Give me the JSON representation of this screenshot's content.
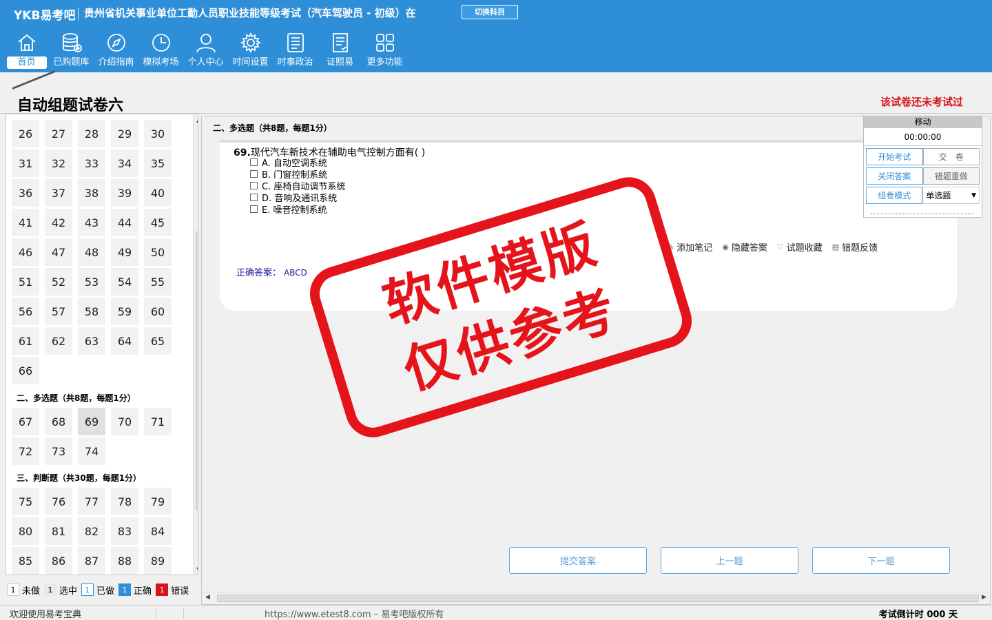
{
  "header": {
    "logo": "YKB易考吧",
    "exam_title": "贵州省机关事业单位工勤人员职业技能等级考试（汽车驾驶员 - 初级）在",
    "switch_label": "切换科目",
    "nav": [
      {
        "label": "首页",
        "icon": "home-icon"
      },
      {
        "label": "已购题库",
        "icon": "database-icon"
      },
      {
        "label": "介绍指南",
        "icon": "compass-icon"
      },
      {
        "label": "模拟考场",
        "icon": "clock-icon"
      },
      {
        "label": "个人中心",
        "icon": "user-icon"
      },
      {
        "label": "时间设置",
        "icon": "gear-icon"
      },
      {
        "label": "时事政治",
        "icon": "news-icon"
      },
      {
        "label": "证照易",
        "icon": "document-icon"
      },
      {
        "label": "更多功能",
        "icon": "grid-icon"
      }
    ]
  },
  "paper": {
    "title": "自动组题试卷六",
    "status": "该试卷还未考试过"
  },
  "left": {
    "group1": [
      "26",
      "27",
      "28",
      "29",
      "30",
      "31",
      "32",
      "33",
      "34",
      "35",
      "36",
      "37",
      "38",
      "39",
      "40",
      "41",
      "42",
      "43",
      "44",
      "45",
      "46",
      "47",
      "48",
      "49",
      "50",
      "51",
      "52",
      "53",
      "54",
      "55",
      "56",
      "57",
      "58",
      "59",
      "60",
      "61",
      "62",
      "63",
      "64",
      "65",
      "66"
    ],
    "section2_label": "二、多选题（共8题，每题1分）",
    "group2": [
      "67",
      "68",
      "69",
      "70",
      "71",
      "72",
      "73",
      "74"
    ],
    "section3_label": "三、判断题（共30题，每题1分）",
    "group3": [
      "75",
      "76",
      "77",
      "78",
      "79",
      "80",
      "81",
      "82",
      "83",
      "84",
      "85",
      "86",
      "87",
      "88",
      "89"
    ],
    "selected": "69"
  },
  "legend": {
    "undone_num": "1",
    "undone_label": "未做",
    "sel_num": "1",
    "sel_label": "选中",
    "done_num": "1",
    "done_label": "已做",
    "right_num": "1",
    "right_label": "正确",
    "wrong_num": "1",
    "wrong_label": "错误"
  },
  "main": {
    "section_label": "二、多选题（共8题，每题1分）",
    "question_num": "69.",
    "question_text": "现代汽车新技术在辅助电气控制方面有( )",
    "options": [
      "A. 自动空调系统",
      "B. 门窗控制系统",
      "C. 座椅自动调节系统",
      "D. 音响及通讯系统",
      "E. 噪音控制系统"
    ],
    "tools": {
      "add_note": "添加笔记",
      "hide_answer": "隐藏答案",
      "favorite": "试题收藏",
      "feedback": "错题反馈"
    },
    "answer_label": "正确答案：",
    "answer_value": "ABCD",
    "submit": "提交答案",
    "prev": "上一题",
    "next": "下一题"
  },
  "control": {
    "move": "移动",
    "time": "00:00:00",
    "start": "开始考试",
    "hand_in": "交　卷",
    "close_answer": "关闭答案",
    "redo_wrong": "错题重做",
    "mode": "组卷模式",
    "type_value": "单选题"
  },
  "stamp": {
    "line1": "软件模版",
    "line2": "仅供参考"
  },
  "statusbar": {
    "welcome": "欢迎使用易考宝典",
    "copyright": "https://www.etest8.com – 易考吧版权所有",
    "countdown": "考试倒计时 000 天"
  },
  "colors": {
    "brand_blue": "#2e8fd8",
    "stamp_red": "#e5141b",
    "status_red": "#d6141a"
  }
}
